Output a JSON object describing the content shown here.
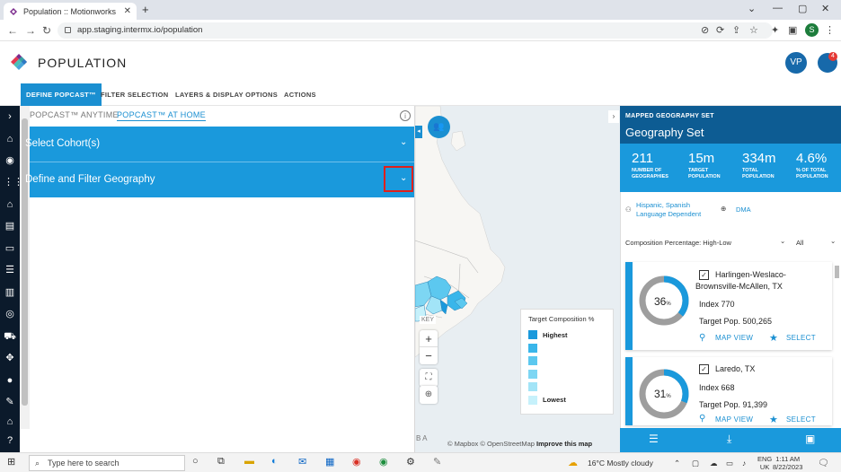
{
  "browser": {
    "tab_title": "Population :: Motionworks",
    "url": "app.staging.intermx.io/population",
    "profile_initial": "S"
  },
  "app": {
    "title": "POPULATION",
    "user_initials": "VP",
    "notification_count": "4"
  },
  "main_nav": [
    {
      "label": "DEFINE POPCAST™"
    },
    {
      "label": "FILTER SELECTION"
    },
    {
      "label": "LAYERS & DISPLAY OPTIONS"
    },
    {
      "label": "ACTIONS"
    }
  ],
  "subtabs": [
    {
      "label": "POPCAST™ ANYTIME"
    },
    {
      "label": "POPCAST™ AT HOME"
    }
  ],
  "accordion": [
    {
      "label": "Select Cohort(s)"
    },
    {
      "label": "Define and Filter Geography"
    }
  ],
  "map": {
    "key_label": "KEY",
    "legend_title": "Target Composition %",
    "legend": [
      {
        "label": "Highest",
        "color": "#1a99dc"
      },
      {
        "label": "",
        "color": "#39b6ea"
      },
      {
        "label": "",
        "color": "#5cc8ef"
      },
      {
        "label": "",
        "color": "#7dd6f3"
      },
      {
        "label": "",
        "color": "#a2e4f7"
      },
      {
        "label": "Lowest",
        "color": "#c6f1fb"
      }
    ],
    "attribution_1": "© Mapbox © OpenStreetMap",
    "attribution_2": "Improve this map",
    "corner_letters": "B A"
  },
  "geography": {
    "kicker": "MAPPED GEOGRAPHY SET",
    "title": "Geography Set",
    "stats": [
      {
        "value": "211",
        "label1": "NUMBER OF",
        "label2": "GEOGRAPHIES"
      },
      {
        "value": "15m",
        "label1": "TARGET",
        "label2": "POPULATION"
      },
      {
        "value": "334m",
        "label1": "TOTAL",
        "label2": "POPULATION"
      },
      {
        "value": "4.6%",
        "label1": "% OF TOTAL",
        "label2": "POPULATION"
      }
    ],
    "tag_1a": "Hispanic, Spanish",
    "tag_1b": "Language Dependent",
    "tag_2": "DMA",
    "sort_label": "Composition Percentage: High-Low",
    "filter_label": "All",
    "cards": [
      {
        "pct": 36,
        "pct_unit": "%",
        "name_1": "Harlingen-Weslaco-",
        "name_2": "Brownsville-McAllen, TX",
        "index": "Index 770",
        "target_pop": "Target Pop. 500,265",
        "map_view": "MAP VIEW",
        "select": "SELECT"
      },
      {
        "pct": 31,
        "pct_unit": "%",
        "name_1": "Laredo, TX",
        "name_2": "",
        "index": "Index 668",
        "target_pop": "Target Pop. 91,399",
        "map_view": "MAP VIEW",
        "select": "SELECT"
      }
    ]
  },
  "taskbar": {
    "search_placeholder": "Type here to search",
    "weather": "16°C  Mostly cloudy",
    "lang_1": "ENG",
    "lang_2": "UK",
    "time": "1:11 AM",
    "date": "8/22/2023"
  }
}
